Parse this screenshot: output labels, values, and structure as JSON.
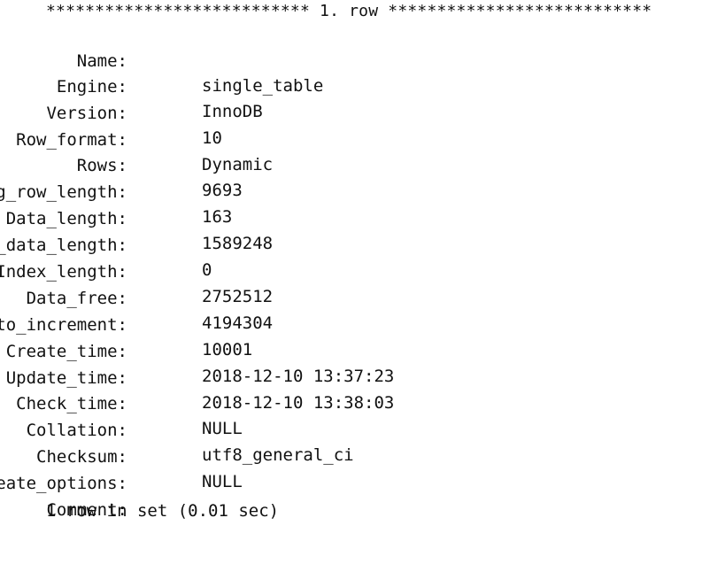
{
  "header": {
    "text": "*************************** 1. row ***************************"
  },
  "fields": [
    {
      "key": "Name:",
      "value": "single_table"
    },
    {
      "key": "Engine:",
      "value": "InnoDB"
    },
    {
      "key": "Version:",
      "value": "10"
    },
    {
      "key": "Row_format:",
      "value": "Dynamic"
    },
    {
      "key": "Rows:",
      "value": "9693"
    },
    {
      "key": "Avg_row_length:",
      "value": "163"
    },
    {
      "key": "Data_length:",
      "value": "1589248"
    },
    {
      "key": "Max_data_length:",
      "value": "0"
    },
    {
      "key": "Index_length:",
      "value": "2752512"
    },
    {
      "key": "Data_free:",
      "value": "4194304"
    },
    {
      "key": "Auto_increment:",
      "value": "10001"
    },
    {
      "key": "Create_time:",
      "value": "2018-12-10 13:37:23"
    },
    {
      "key": "Update_time:",
      "value": "2018-12-10 13:38:03"
    },
    {
      "key": "Check_time:",
      "value": "NULL"
    },
    {
      "key": "Collation:",
      "value": "utf8_general_ci"
    },
    {
      "key": "Checksum:",
      "value": "NULL"
    },
    {
      "key": "Create_options:",
      "value": ""
    },
    {
      "key": "Comment:",
      "value": ""
    }
  ],
  "footer": {
    "text": "1 row in set (0.01 sec)"
  }
}
